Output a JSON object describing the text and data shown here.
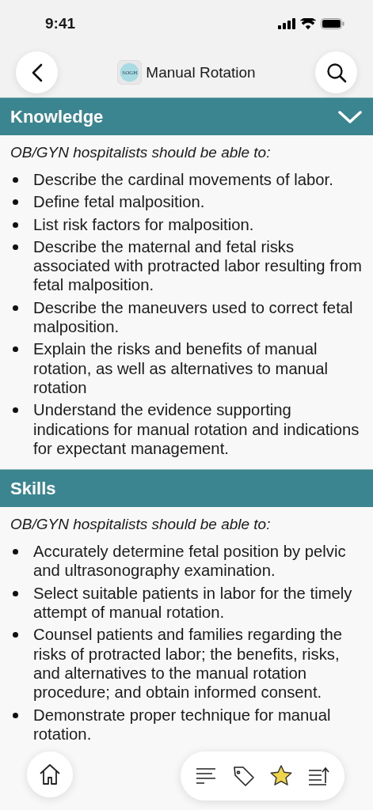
{
  "status_bar": {
    "time": "9:41"
  },
  "nav": {
    "title": "Manual Rotation",
    "logo_text": "SOGH"
  },
  "sections": [
    {
      "title": "Knowledge",
      "expanded": true,
      "intro": "OB/GYN hospitalists should be able to:",
      "items": [
        "Describe the cardinal movements of labor.",
        "Define fetal malposition.",
        "List risk factors for malposition.",
        "Describe the maternal and fetal risks associated with protracted labor resulting from fetal malposition.",
        "Describe the maneuvers used to correct fetal malposition.",
        "Explain the risks and benefits of manual rotation, as well as alternatives to manual rotation",
        "Understand the evidence supporting indications for manual rotation and indications for expectant management."
      ]
    },
    {
      "title": "Skills",
      "intro": "OB/GYN hospitalists should be able to:",
      "items": [
        "Accurately determine fetal position by pelvic and ultrasonography examination.",
        "Select suitable patients in labor for the timely attempt of manual rotation.",
        "Counsel patients and families regarding the risks of protracted labor; the benefits, risks, and alternatives to the manual rotation procedure; and obtain informed consent.",
        "Demonstrate proper technique for manual rotation."
      ]
    }
  ],
  "toolbar": [
    {
      "kind": "contents",
      "selected": false
    },
    {
      "kind": "tag",
      "selected": false
    },
    {
      "kind": "star",
      "selected": true
    },
    {
      "kind": "share",
      "selected": false
    }
  ]
}
